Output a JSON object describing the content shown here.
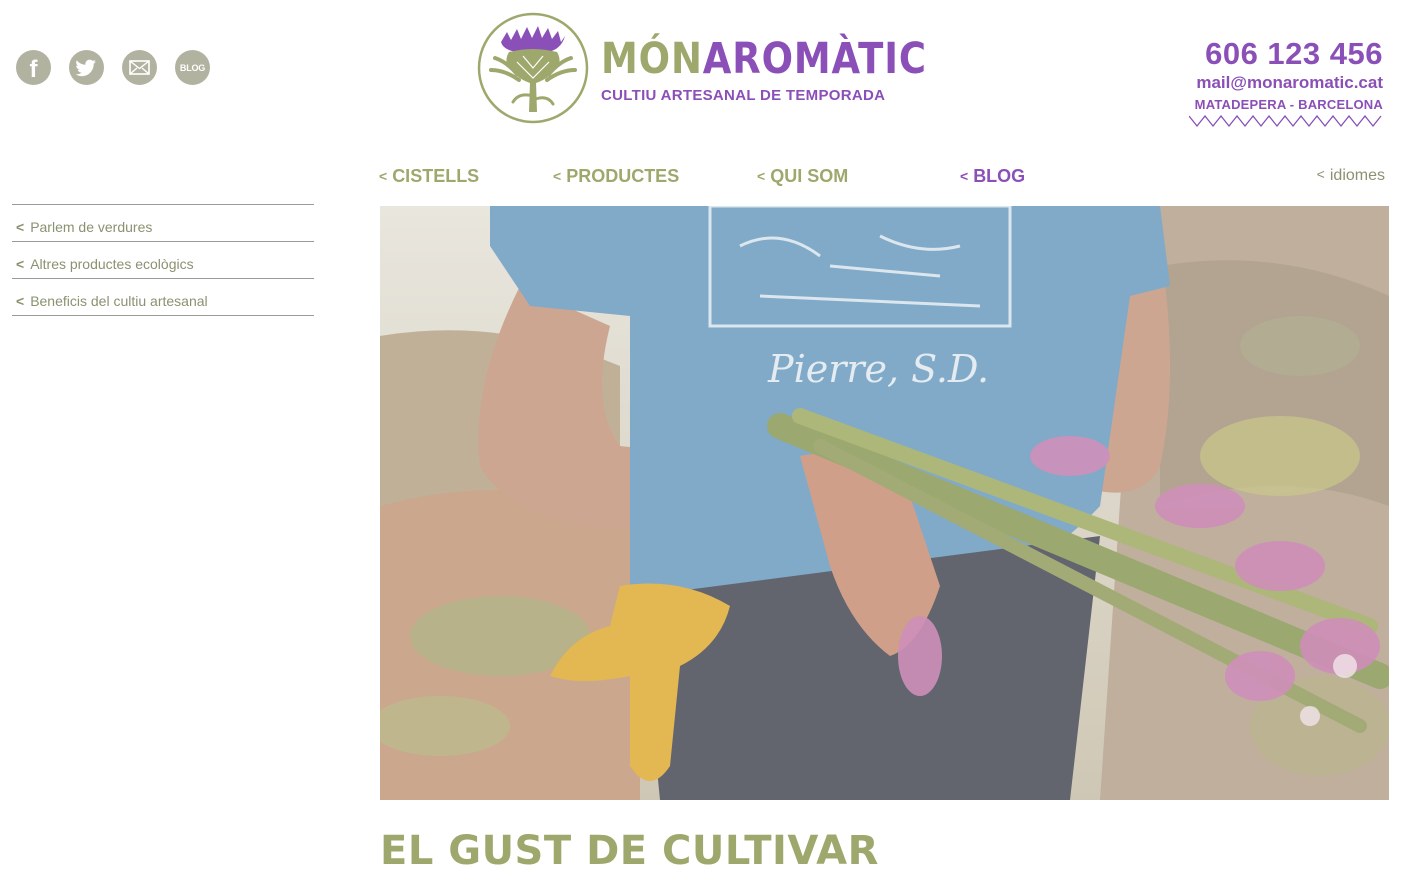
{
  "social": {
    "facebook_icon": "facebook-icon",
    "twitter_icon": "twitter-icon",
    "mail_icon": "mail-icon",
    "blog_label": "BLOG"
  },
  "logo": {
    "name_part1": "MÓN",
    "name_part2": "AROMÀTIC",
    "tagline": "CULTIU ARTESANAL DE TEMPORADA",
    "emblem_icon": "artichoke-icon"
  },
  "contact": {
    "phone": "606 123 456",
    "email": "mail@monaromatic.cat",
    "location": "MATADEPERA - BARCELONA"
  },
  "nav": {
    "arrow": "<",
    "items": [
      {
        "label": "CISTELLS"
      },
      {
        "label": "PRODUCTES"
      },
      {
        "label": "QUI SOM"
      },
      {
        "label": "BLOG",
        "active": true
      }
    ],
    "language": "idiomes"
  },
  "sidebar": {
    "arrow": "<",
    "items": [
      {
        "label": "Parlem de verdures"
      },
      {
        "label": "Altres productes ecològics"
      },
      {
        "label": "Beneficis del cultiu artesanal"
      }
    ]
  },
  "hero": {
    "shirt_text": "Pierre, S.D."
  },
  "headline": "EL GUST DE CULTIVAR",
  "colors": {
    "olive": "#9ea86d",
    "purple": "#8b4fb8",
    "icon_gray": "#b2b2a1",
    "sidebar_text": "#8a9270"
  }
}
